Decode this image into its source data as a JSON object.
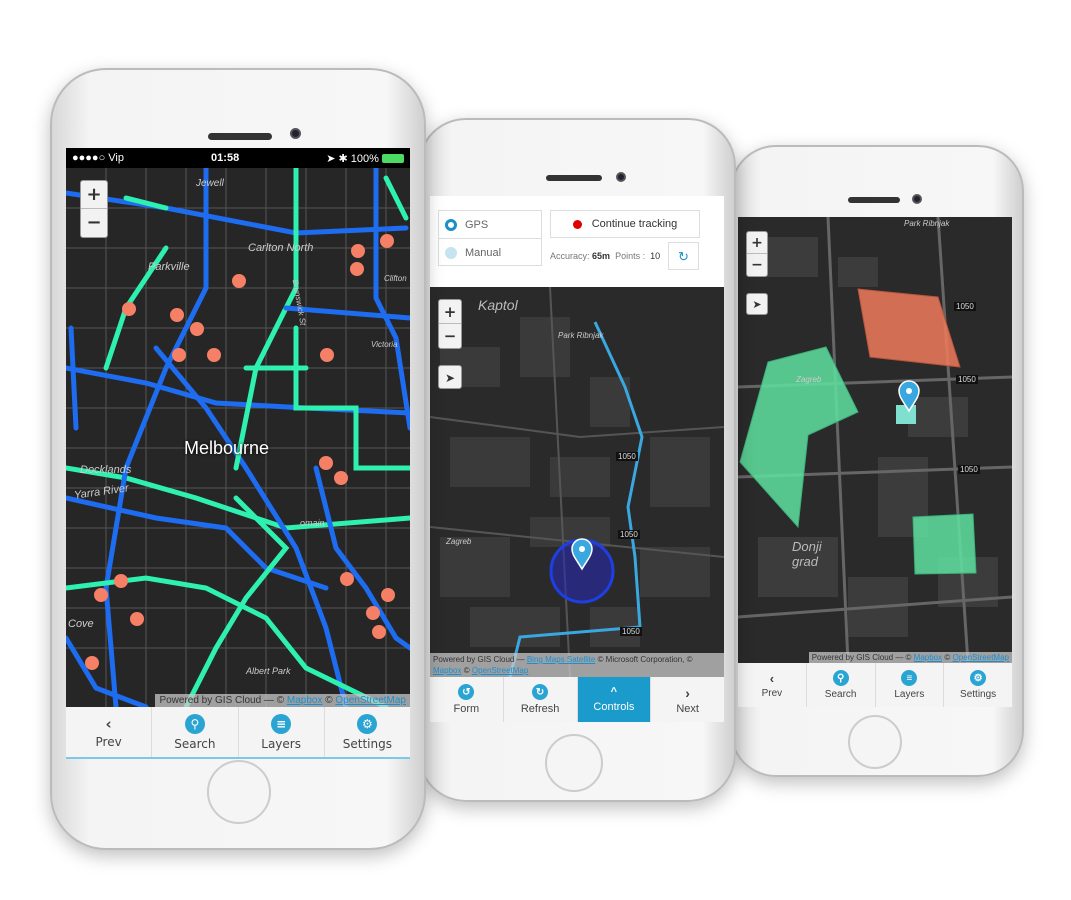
{
  "phone1": {
    "status": {
      "carrier": "●●●●○ Vip",
      "time": "01:58",
      "battery": "100%"
    },
    "zoom_in": "+",
    "zoom_out": "−",
    "map_labels": [
      "Jewell",
      "Carlton North",
      "Parkville",
      "Melbourne",
      "Docklands",
      "Yarra River",
      "Cove",
      "Albert Park",
      "Brunswick St",
      "Victoria",
      "Clifton",
      "omain"
    ],
    "attribution": {
      "prefix": "Powered by GIS Cloud — ©",
      "mapbox": "Mapbox",
      "sep": "©",
      "osm": "OpenStreetMap"
    },
    "nav": [
      {
        "label": "Prev",
        "icon": "chevron-left-icon"
      },
      {
        "label": "Search",
        "icon": "search-icon"
      },
      {
        "label": "Layers",
        "icon": "layers-icon"
      },
      {
        "label": "Settings",
        "icon": "gear-icon"
      }
    ]
  },
  "phone2": {
    "mode_options": [
      {
        "label": "GPS",
        "selected": true
      },
      {
        "label": "Manual",
        "selected": false
      }
    ],
    "tracking_button": "Continue tracking",
    "accuracy_label": "Accuracy:",
    "accuracy_value": "65m",
    "points_label": "Points :",
    "points_value": "10",
    "zoom_in": "+",
    "zoom_out": "−",
    "map_labels": [
      "Kaptol",
      "Park Ribnjak",
      "Zagreb",
      "1050",
      "1050",
      "1050"
    ],
    "attribution": {
      "prefix": "Powered by GIS Cloud —",
      "bing": "Bing Maps Satellite",
      "ms": "© Microsoft Corporation, ©",
      "mapbox": "Mapbox",
      "sep": "©",
      "osm": "OpenStreetMap"
    },
    "nav": [
      {
        "label": "Form",
        "icon": "undo-icon"
      },
      {
        "label": "Refresh",
        "icon": "refresh-icon"
      },
      {
        "label": "Controls",
        "icon": "chevron-up-icon",
        "active": true
      },
      {
        "label": "Next",
        "icon": "chevron-right-icon"
      }
    ]
  },
  "phone3": {
    "zoom_in": "+",
    "zoom_out": "−",
    "map_labels": [
      "Park Ribnjak",
      "Zagreb",
      "Donji grad",
      "1050",
      "1050",
      "1050"
    ],
    "attribution": {
      "prefix": "Powered by GIS Cloud — ©",
      "mapbox": "Mapbox",
      "sep": "©",
      "osm": "OpenStreetMap"
    },
    "nav": [
      {
        "label": "Prev",
        "icon": "chevron-left-icon"
      },
      {
        "label": "Search",
        "icon": "search-icon"
      },
      {
        "label": "Layers",
        "icon": "layers-icon"
      },
      {
        "label": "Settings",
        "icon": "gear-icon"
      }
    ]
  },
  "colors": {
    "accent": "#2aa5d3",
    "point": "#f58066",
    "polygon_green": "#5fe0a0",
    "polygon_red": "#f07a5a",
    "record": "#e00000",
    "track": "#3aa8e0"
  }
}
